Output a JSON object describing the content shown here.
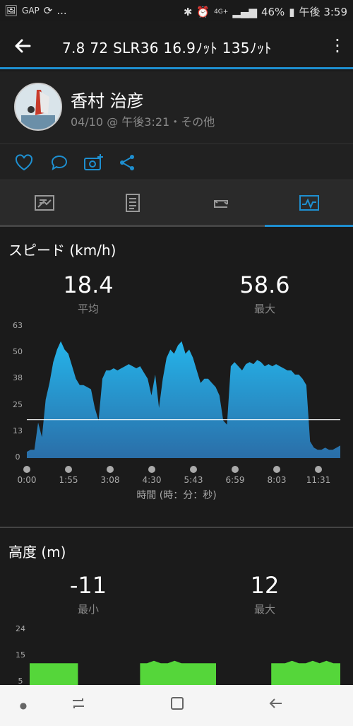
{
  "status": {
    "left_text": "GAP",
    "ellipsis": "...",
    "network": "4G+",
    "battery": "46%",
    "time": "午後 3:59"
  },
  "topbar": {
    "title": "7.8  72   SLR36   16.9ﾉｯﾄ   135ﾉｯﾄ"
  },
  "activity": {
    "user_name": "香村 治彦",
    "meta": "04/10 @ 午後3:21・その他"
  },
  "speed": {
    "title": "スピード (km/h)",
    "avg_value": "18.4",
    "avg_label": "平均",
    "max_value": "58.6",
    "max_label": "最大",
    "xaxis_label": "時間 (時：分：秒)"
  },
  "altitude": {
    "title": "高度 (m)",
    "min_value": "-11",
    "min_label": "最小",
    "max_value": "12",
    "max_label": "最大"
  },
  "colors": {
    "accent": "#1e8fd0",
    "speed_fill": "#2aa6dd",
    "altitude_fill": "#55d63a"
  },
  "chart_data": [
    {
      "type": "area",
      "title": "スピード (km/h)",
      "xlabel": "時間 (時：分：秒)",
      "ylabel": "",
      "ylim": [
        0,
        63
      ],
      "yticks": [
        "63",
        "50",
        "38",
        "25",
        "13",
        "0"
      ],
      "categories": [
        "0:00",
        "1:55",
        "3:08",
        "4:30",
        "5:43",
        "6:59",
        "8:03",
        "11:31"
      ],
      "reference_line": 18.4,
      "x": [
        0,
        1,
        2,
        3,
        4,
        5,
        6,
        7,
        8,
        9,
        10,
        11,
        12,
        13,
        14,
        15,
        16,
        17,
        18,
        19,
        20,
        21,
        22,
        23,
        24,
        25,
        26,
        27,
        28,
        29,
        30,
        31,
        32,
        33,
        34,
        35,
        36,
        37,
        38,
        39,
        40,
        41,
        42,
        43,
        44,
        45,
        46,
        47,
        48,
        49,
        50,
        51,
        52,
        53,
        54,
        55,
        56,
        57,
        58,
        59,
        60,
        61,
        62,
        63,
        64,
        65,
        66,
        67,
        68,
        69,
        70,
        71,
        72,
        73,
        74,
        75,
        76,
        77,
        78,
        79,
        80,
        81,
        82,
        83,
        84,
        85,
        86,
        87,
        88,
        89,
        90,
        91,
        92,
        93,
        94,
        95,
        96,
        97,
        98,
        99,
        100
      ],
      "values": [
        3,
        4,
        4,
        17,
        10,
        28,
        36,
        46,
        52,
        56,
        52,
        50,
        44,
        38,
        35,
        35,
        34,
        33,
        24,
        18,
        38,
        42,
        42,
        43,
        42,
        43,
        44,
        45,
        44,
        43,
        44,
        41,
        38,
        30,
        40,
        24,
        38,
        48,
        52,
        50,
        54,
        56,
        50,
        52,
        48,
        42,
        36,
        38,
        38,
        36,
        34,
        30,
        18,
        16,
        44,
        46,
        44,
        42,
        45,
        46,
        45,
        47,
        46,
        44,
        45,
        44,
        45,
        44,
        43,
        42,
        42,
        40,
        40,
        38,
        35,
        8,
        5,
        4,
        4,
        5,
        4,
        4,
        5,
        6
      ],
      "series": [
        {
          "name": "",
          "values": []
        }
      ]
    },
    {
      "type": "area",
      "title": "高度 (m)",
      "ylim": [
        0,
        24
      ],
      "yticks": [
        "24",
        "15",
        "5"
      ],
      "values": [
        8,
        8,
        8,
        8,
        8,
        8,
        8,
        8,
        0,
        0,
        0,
        0,
        0,
        0,
        0,
        0,
        8,
        8,
        9,
        8,
        8,
        9,
        8,
        8,
        8,
        8,
        8,
        8,
        0,
        0,
        0,
        0,
        0,
        0,
        0,
        8,
        8,
        8,
        9,
        8,
        8,
        9,
        8,
        9,
        8,
        8
      ]
    }
  ]
}
